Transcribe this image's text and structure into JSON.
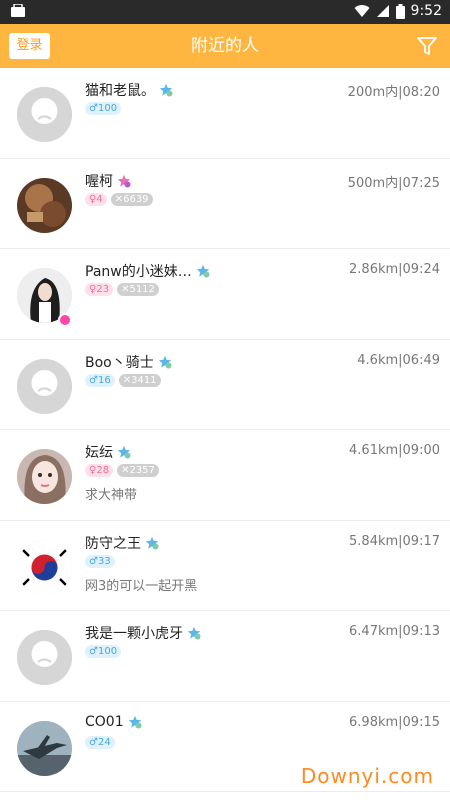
{
  "status_bar": {
    "time": "9:52",
    "icons": [
      "notification-icon",
      "wifi-icon",
      "signal-icon",
      "battery-icon"
    ]
  },
  "app_bar": {
    "login_label": "登录",
    "title": "附近的人",
    "filter_icon": "filter-icon"
  },
  "users": [
    {
      "name": "猫和老鼠。",
      "gender": "male",
      "gender_symbol": "♂",
      "age": "100",
      "rank": "",
      "meta": "200m内|08:20",
      "signature": "",
      "avatar": "default"
    },
    {
      "name": "喔柯",
      "gender": "female",
      "gender_symbol": "♀",
      "age": "4",
      "rank": "6639",
      "meta": "500m内|07:25",
      "signature": "",
      "avatar": "photo-brown"
    },
    {
      "name": "Panw的小迷妹…",
      "gender": "female",
      "gender_symbol": "♀",
      "age": "23",
      "rank": "5112",
      "meta": "2.86km|09:24",
      "signature": "",
      "avatar": "photo-girl"
    },
    {
      "name": "Boo丶骑士",
      "gender": "male",
      "gender_symbol": "♂",
      "age": "16",
      "rank": "3411",
      "meta": "4.6km|06:49",
      "signature": "",
      "avatar": "default"
    },
    {
      "name": "妘纭",
      "gender": "female",
      "gender_symbol": "♀",
      "age": "28",
      "rank": "2357",
      "meta": "4.61km|09:00",
      "signature": "求大神带",
      "avatar": "photo-face"
    },
    {
      "name": "防守之王",
      "gender": "male",
      "gender_symbol": "♂",
      "age": "33",
      "rank": "",
      "meta": "5.84km|09:17",
      "signature": "网3的可以一起开黑",
      "avatar": "photo-flag"
    },
    {
      "name": "我是一颗小虎牙",
      "gender": "male",
      "gender_symbol": "♂",
      "age": "100",
      "rank": "",
      "meta": "6.47km|09:13",
      "signature": "",
      "avatar": "default"
    },
    {
      "name": "CO01",
      "gender": "male",
      "gender_symbol": "♂",
      "age": "24",
      "rank": "",
      "meta": "6.98km|09:15",
      "signature": "",
      "avatar": "photo-jet"
    }
  ],
  "watermark": "Downyi.com",
  "colors": {
    "accent": "#ffb640",
    "male_tag": "#4aa8de",
    "female_tag": "#ef6f98"
  }
}
